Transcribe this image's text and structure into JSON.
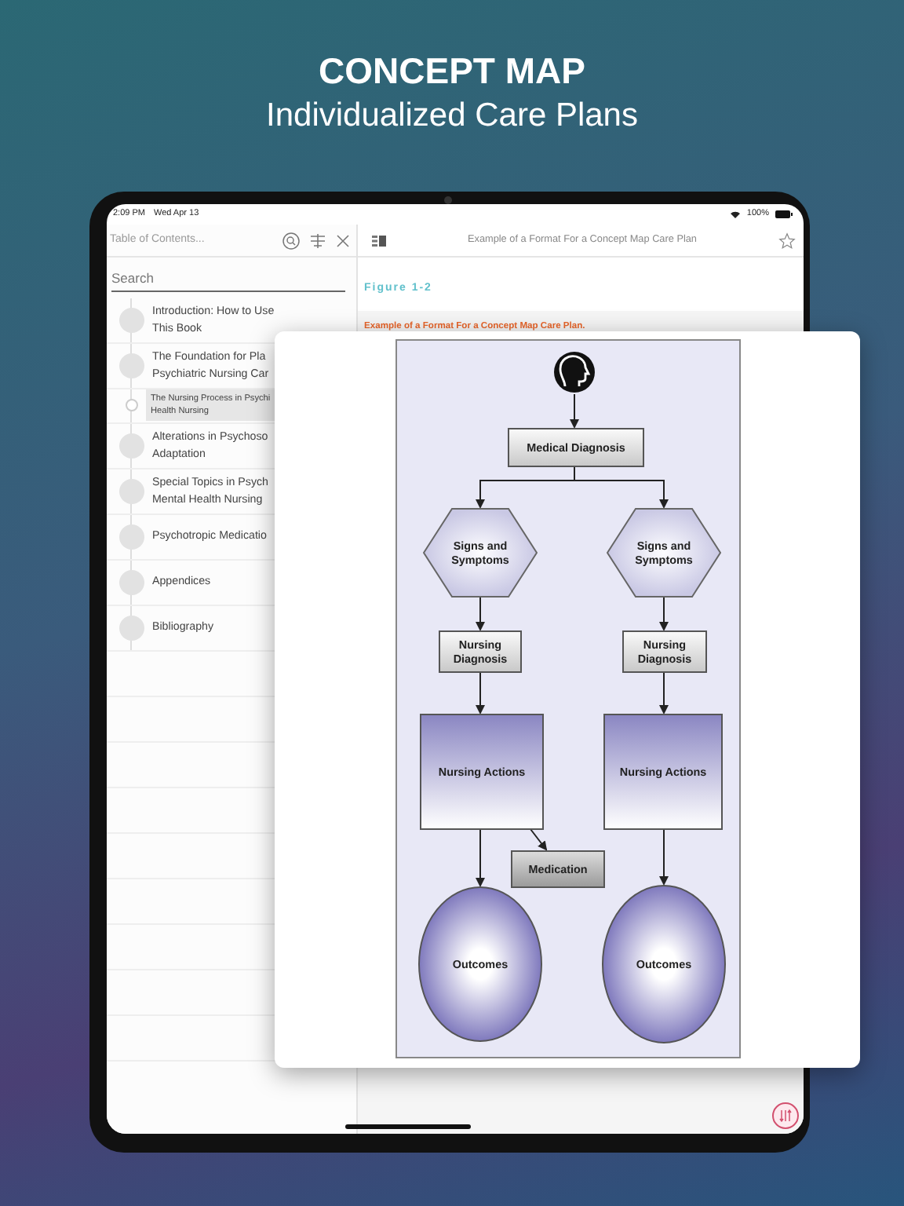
{
  "headline": {
    "title": "CONCEPT MAP",
    "subtitle": "Individualized Care Plans"
  },
  "status_bar": {
    "time": "2:09 PM",
    "date": "Wed Apr 13",
    "battery": "100%"
  },
  "sidebar": {
    "title": "Table of Contents...",
    "search": {
      "placeholder": "Search"
    },
    "items": [
      {
        "lines": [
          "Introduction: How to Use",
          "This Book"
        ],
        "selected": false
      },
      {
        "lines": [
          "The Foundation for Pla",
          "Psychiatric Nursing Car"
        ],
        "selected": false,
        "children": [
          {
            "lines": [
              "The Nursing Process in Psychi",
              "Health Nursing"
            ],
            "selected": true
          }
        ]
      },
      {
        "lines": [
          "Alterations in Psychoso",
          "Adaptation"
        ],
        "selected": false
      },
      {
        "lines": [
          "Special Topics in Psych",
          "Mental Health Nursing"
        ],
        "selected": false
      },
      {
        "lines": [
          "Psychotropic Medicatio"
        ],
        "selected": false
      },
      {
        "lines": [
          "Appendices"
        ],
        "selected": false
      },
      {
        "lines": [
          "Bibliography"
        ],
        "selected": false
      }
    ]
  },
  "reader": {
    "title": "Example of a Format For a Concept Map Care Plan",
    "figure_label": "Figure 1-2",
    "caption": "Example of a Format For a Concept Map Care Plan."
  },
  "figure_popup": {
    "nodes": [
      {
        "kind": "head"
      },
      {
        "kind": "step",
        "lines": [
          "Medical Diagnosis"
        ]
      },
      {
        "kind": "hexagon",
        "lines": [
          "Signs and",
          "Symptoms"
        ]
      },
      {
        "kind": "hexagon",
        "lines": [
          "Signs and",
          "Symptoms"
        ]
      },
      {
        "kind": "step",
        "lines": [
          "Nursing",
          "Diagnosis"
        ]
      },
      {
        "kind": "step",
        "lines": [
          "Nursing",
          "Diagnosis"
        ]
      },
      {
        "kind": "process",
        "lines": [
          "Nursing Actions"
        ]
      },
      {
        "kind": "process",
        "lines": [
          "Nursing Actions"
        ]
      },
      {
        "kind": "note",
        "lines": [
          "Medication"
        ]
      },
      {
        "kind": "ellipse",
        "lines": [
          "Outcomes"
        ]
      },
      {
        "kind": "ellipse",
        "lines": [
          "Outcomes"
        ]
      }
    ]
  }
}
